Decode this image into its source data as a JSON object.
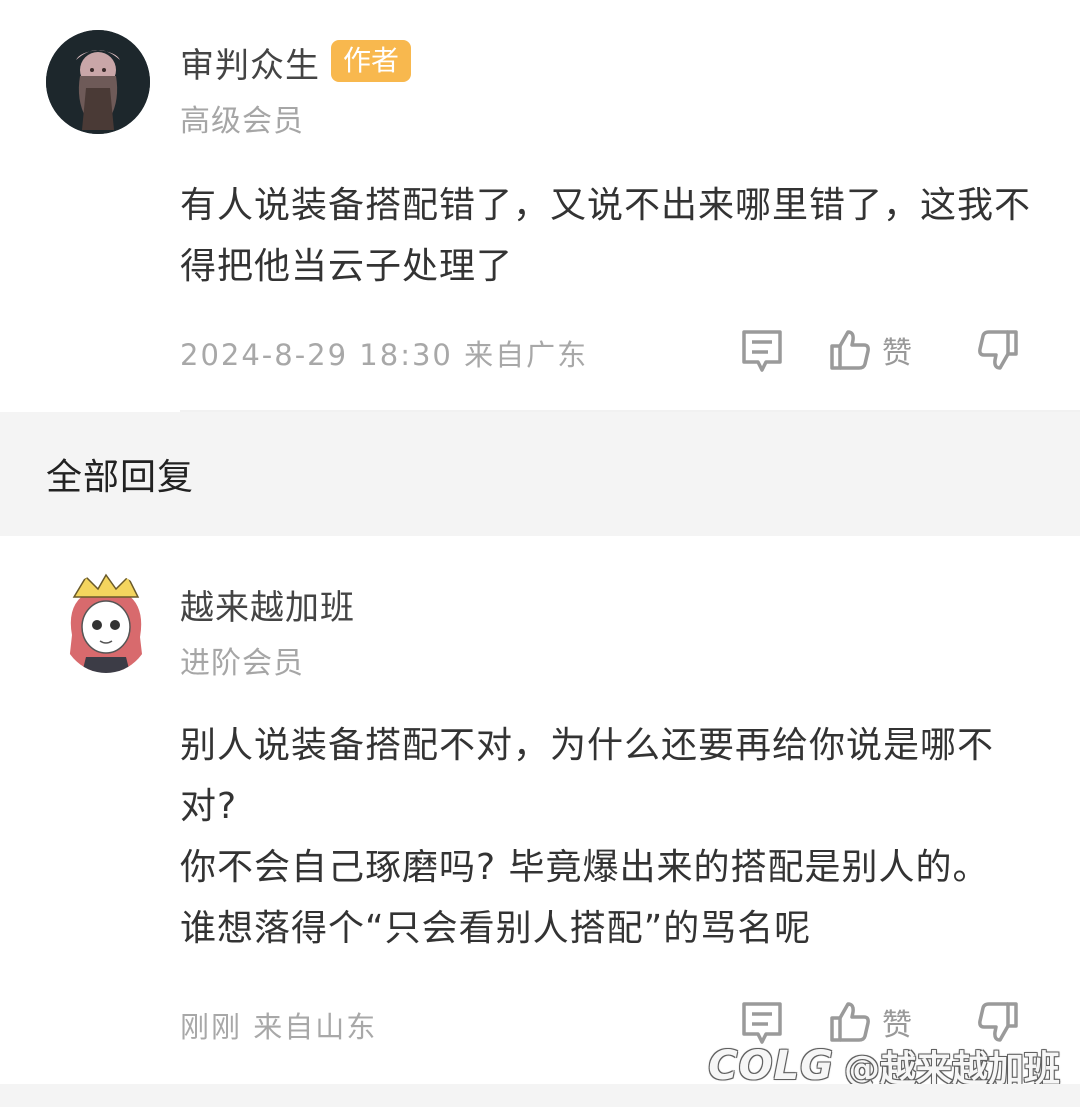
{
  "comment": {
    "username": "审判众生",
    "badge": "作者",
    "level": "高级会员",
    "content": "有人说装备搭配错了，又说不出来哪里错了，这我不得把他当云子处理了",
    "timestamp": "2024-8-29 18:30",
    "location": "来自广东",
    "like_label": "赞"
  },
  "section": {
    "title": "全部回复"
  },
  "reply": {
    "username": "越来越加班",
    "level": "进阶会员",
    "content": "别人说装备搭配不对，为什么还要再给你说是哪不对?\n你不会自己琢磨吗? 毕竟爆出来的搭配是别人的。\n谁想落得个“只会看别人搭配”的骂名呢",
    "timestamp": "刚刚",
    "location": "来自山东",
    "like_label": "赞"
  },
  "watermark": {
    "logo": "COLG",
    "user": "@越来越加班"
  },
  "colors": {
    "badge": "#f8b84e",
    "divider": "#f4f4f4",
    "muted_text": "#a8a8a8"
  },
  "icons": {
    "reply": "comment-icon",
    "like": "thumbs-up-icon",
    "dislike": "thumbs-down-icon"
  }
}
